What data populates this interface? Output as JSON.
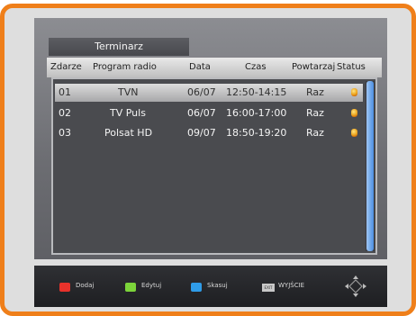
{
  "title": "Terminarz",
  "columns": {
    "event": "Zdarze",
    "program": "Program radio",
    "date": "Data",
    "time": "Czas",
    "repeat": "Powtarzaj",
    "status": "Status"
  },
  "rows": [
    {
      "event": "01",
      "program": "TVN",
      "date": "06/07",
      "time": "12:50-14:15",
      "repeat": "Raz",
      "status_icon": "alarm-clock-icon"
    },
    {
      "event": "02",
      "program": "TV Puls",
      "date": "06/07",
      "time": "16:00-17:00",
      "repeat": "Raz",
      "status_icon": "alarm-clock-icon"
    },
    {
      "event": "03",
      "program": "Polsat HD",
      "date": "09/07",
      "time": "18:50-19:20",
      "repeat": "Raz",
      "status_icon": "alarm-clock-icon"
    }
  ],
  "selected_row": 0,
  "footer": {
    "red": "Dodaj",
    "green": "Edytuj",
    "blue": "Skasuj",
    "exit_key": "EXIT",
    "exit": "WYJŚCIE"
  },
  "colors": {
    "frame": "#ef7f1a",
    "red_key": "#e8322b",
    "green_key": "#7cd43a",
    "blue_key": "#2f9ce8",
    "scrollbar": "#4c8fe2"
  }
}
